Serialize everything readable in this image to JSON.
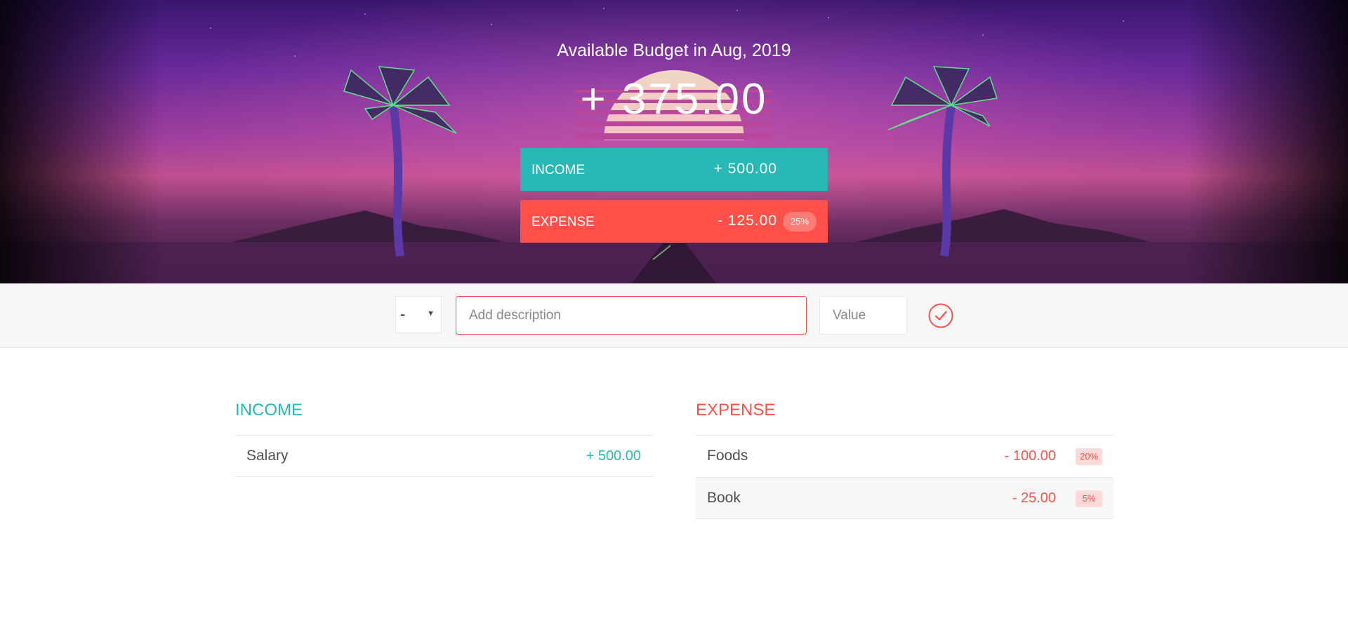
{
  "header": {
    "title": "Available Budget in Aug, 2019",
    "total": "+ 375.00",
    "income": {
      "label": "INCOME",
      "value": "+ 500.00"
    },
    "expense": {
      "label": "EXPENSE",
      "value": "- 125.00",
      "percentage": "25%"
    }
  },
  "add_form": {
    "type_value": "-",
    "description_placeholder": "Add description",
    "value_placeholder": "Value",
    "submit_icon": "checkmark-circle-icon"
  },
  "income_list": {
    "title": "INCOME",
    "items": [
      {
        "description": "Salary",
        "value": "+ 500.00"
      }
    ]
  },
  "expense_list": {
    "title": "EXPENSE",
    "items": [
      {
        "description": "Foods",
        "value": "- 100.00",
        "percentage": "20%"
      },
      {
        "description": "Book",
        "value": "- 25.00",
        "percentage": "5%"
      }
    ]
  },
  "colors": {
    "income": "#28b9b5",
    "expense": "#ff5049",
    "expense_badge_bg": "#ffdad9"
  }
}
